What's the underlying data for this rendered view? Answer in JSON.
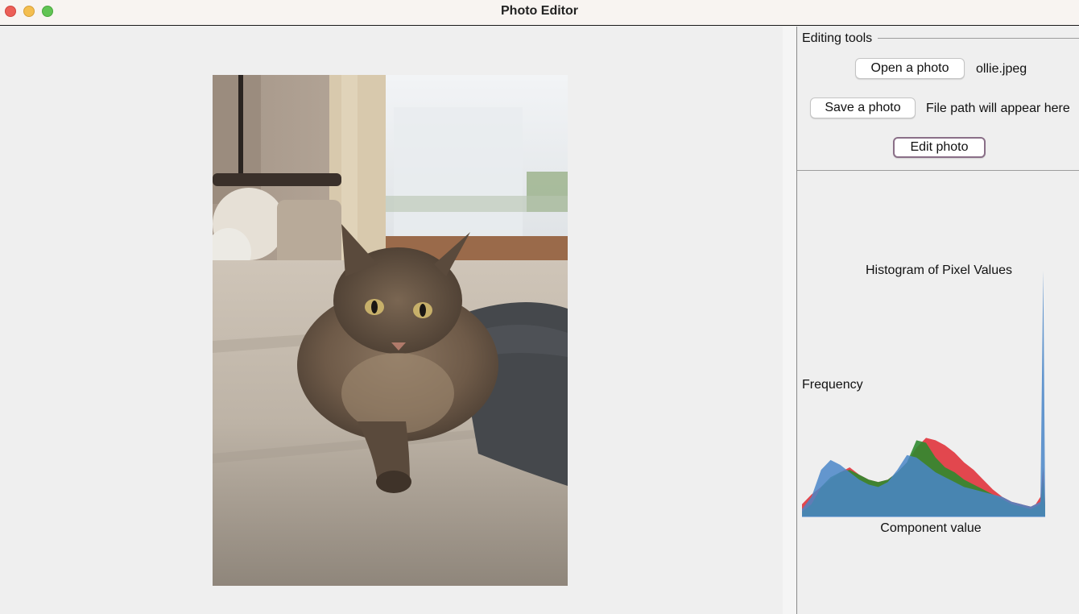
{
  "window": {
    "title": "Photo Editor"
  },
  "photo": {
    "description_icon": "cat-photo"
  },
  "tools": {
    "group_title": "Editing tools",
    "open_button": "Open a photo",
    "open_filename": "ollie.jpeg",
    "save_button": "Save a photo",
    "save_path": "File path will appear here",
    "edit_button": "Edit photo"
  },
  "colors": {
    "red": "#e0343c",
    "green": "#2f8a2f",
    "blue": "#4a86c8",
    "lightblue": "#6f8fe8"
  },
  "chart_data": {
    "type": "area",
    "title": "Histogram of Pixel Values",
    "xlabel": "Component value",
    "ylabel": "Frequency",
    "xlim": [
      0,
      255
    ],
    "grid": false,
    "legend": "none",
    "series": [
      {
        "name": "Red",
        "x": [
          0,
          10,
          20,
          30,
          40,
          50,
          60,
          70,
          80,
          90,
          100,
          110,
          120,
          130,
          140,
          150,
          160,
          170,
          180,
          190,
          200,
          210,
          220,
          230,
          240,
          245,
          250,
          253,
          255
        ],
        "values": [
          0.05,
          0.09,
          0.12,
          0.15,
          0.18,
          0.2,
          0.17,
          0.15,
          0.14,
          0.15,
          0.18,
          0.22,
          0.28,
          0.32,
          0.31,
          0.29,
          0.26,
          0.22,
          0.19,
          0.15,
          0.11,
          0.08,
          0.06,
          0.05,
          0.04,
          0.05,
          0.08,
          0.2,
          0.05
        ]
      },
      {
        "name": "Green",
        "x": [
          0,
          10,
          20,
          30,
          40,
          50,
          60,
          70,
          80,
          90,
          100,
          110,
          120,
          130,
          140,
          150,
          160,
          170,
          180,
          190,
          200,
          210,
          220,
          230,
          240,
          245,
          250,
          253,
          255
        ],
        "values": [
          0.02,
          0.05,
          0.12,
          0.16,
          0.18,
          0.19,
          0.17,
          0.15,
          0.14,
          0.15,
          0.18,
          0.22,
          0.31,
          0.3,
          0.24,
          0.2,
          0.18,
          0.15,
          0.13,
          0.11,
          0.09,
          0.07,
          0.05,
          0.04,
          0.03,
          0.04,
          0.05,
          0.15,
          0.04
        ]
      },
      {
        "name": "Blue",
        "x": [
          0,
          10,
          20,
          30,
          40,
          50,
          60,
          70,
          80,
          90,
          100,
          110,
          120,
          130,
          140,
          150,
          160,
          170,
          180,
          190,
          200,
          210,
          220,
          230,
          240,
          245,
          250,
          253,
          255
        ],
        "values": [
          0.03,
          0.08,
          0.19,
          0.23,
          0.21,
          0.18,
          0.15,
          0.13,
          0.12,
          0.14,
          0.19,
          0.25,
          0.24,
          0.21,
          0.18,
          0.16,
          0.14,
          0.12,
          0.11,
          0.1,
          0.09,
          0.08,
          0.06,
          0.05,
          0.04,
          0.05,
          0.06,
          1.0,
          0.03
        ]
      }
    ]
  }
}
